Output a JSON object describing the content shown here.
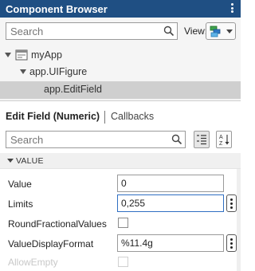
{
  "app": {
    "title": "Component Browser"
  },
  "component_search": {
    "placeholder": "Search",
    "value": ""
  },
  "view": {
    "label": "View:"
  },
  "tree": {
    "root": "myApp",
    "figure": "app.UIFigure",
    "selected": "app.EditField"
  },
  "inspector": {
    "tabs": [
      {
        "label": "Edit Field (Numeric)"
      },
      {
        "label": "Callbacks"
      }
    ],
    "search": {
      "placeholder": "Search",
      "value": ""
    },
    "section": "VALUE",
    "properties": [
      {
        "label": "Value",
        "value": "0"
      },
      {
        "label": "Limits",
        "value": "0,255"
      },
      {
        "label": "RoundFractionalValues",
        "checked": false
      },
      {
        "label": "ValueDisplayFormat",
        "value": "%11.4g"
      },
      {
        "label": "AllowEmpty",
        "checked": false
      }
    ]
  },
  "colors": {
    "title_bar": "#1f4f83",
    "selection": "#cfcfcf",
    "focus": "#2f6fc2"
  },
  "icons": [
    "more-options-icon",
    "search-icon",
    "view-mode-icon",
    "chevron-down-icon",
    "app-icon",
    "categorize-icon",
    "sort-alpha-icon"
  ]
}
